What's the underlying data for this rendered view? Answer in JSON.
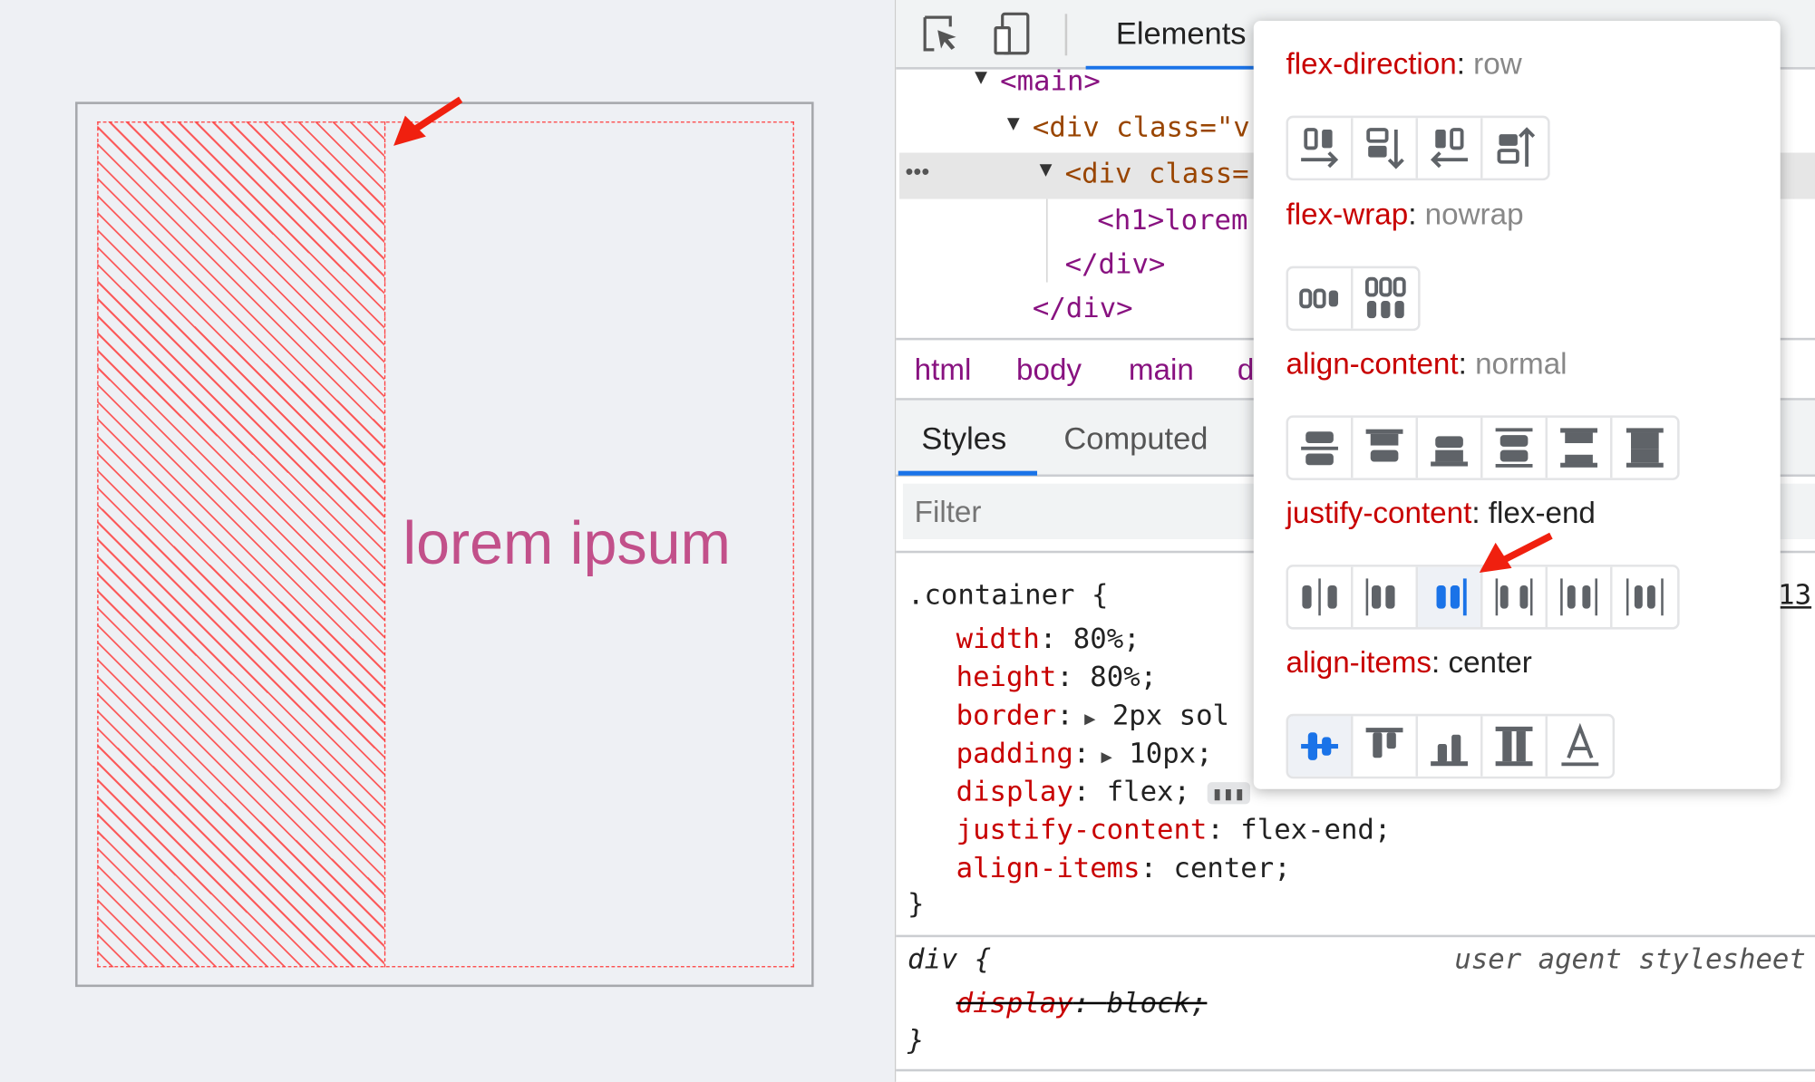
{
  "preview": {
    "heading": "lorem ipsum"
  },
  "devtools": {
    "toolbar": {
      "inspect_icon": "inspect-element-icon",
      "device_icon": "device-toolbar-icon",
      "elements_tab": "Elements"
    },
    "dom": {
      "rows": [
        "<main>",
        "<div class=\"v",
        "<div class=",
        "<h1>lorem",
        "</div>",
        "</div>"
      ],
      "ellipsis": "•••"
    },
    "breadcrumbs": [
      "html",
      "body",
      "main",
      "d"
    ],
    "tabs": {
      "styles": "Styles",
      "computed": "Computed"
    },
    "filter_placeholder": "Filter",
    "rules": [
      {
        "selector": ".container {",
        "source": "13",
        "decls": [
          {
            "p": "width",
            "v": "80%;"
          },
          {
            "p": "height",
            "v": "80%;"
          },
          {
            "p": "border",
            "v": "2px sol"
          },
          {
            "p": "padding",
            "v": "10px;"
          },
          {
            "p": "display",
            "v": "flex;"
          },
          {
            "p": "justify-content",
            "v": "flex-end;"
          },
          {
            "p": "align-items",
            "v": "center;"
          }
        ],
        "close": "}"
      },
      {
        "selector": "div {",
        "source": "user agent stylesheet",
        "decls": [
          {
            "p": "display",
            "v": "block;"
          }
        ],
        "close": "}"
      }
    ]
  },
  "flex_editor": {
    "sections": [
      {
        "prop": "flex-direction",
        "value": "row",
        "value_default": true,
        "options": [
          "row",
          "column",
          "row-reverse",
          "column-reverse"
        ]
      },
      {
        "prop": "flex-wrap",
        "value": "nowrap",
        "value_default": true,
        "options": [
          "nowrap",
          "wrap"
        ]
      },
      {
        "prop": "align-content",
        "value": "normal",
        "value_default": true,
        "options": [
          "center",
          "flex-start",
          "flex-end",
          "space-around",
          "space-between",
          "stretch"
        ]
      },
      {
        "prop": "justify-content",
        "value": "flex-end",
        "value_default": false,
        "selected": "flex-end",
        "options": [
          "center",
          "flex-start",
          "flex-end",
          "space-between",
          "space-around",
          "space-evenly"
        ]
      },
      {
        "prop": "align-items",
        "value": "center",
        "value_default": false,
        "selected": "center",
        "options": [
          "center",
          "flex-start",
          "flex-end",
          "stretch",
          "baseline"
        ]
      }
    ]
  },
  "colors": {
    "accent": "#1a73e8",
    "property": "#c80000",
    "tag": "#881280",
    "heading": "#c2508a",
    "overlay": "#ff3b3b"
  }
}
